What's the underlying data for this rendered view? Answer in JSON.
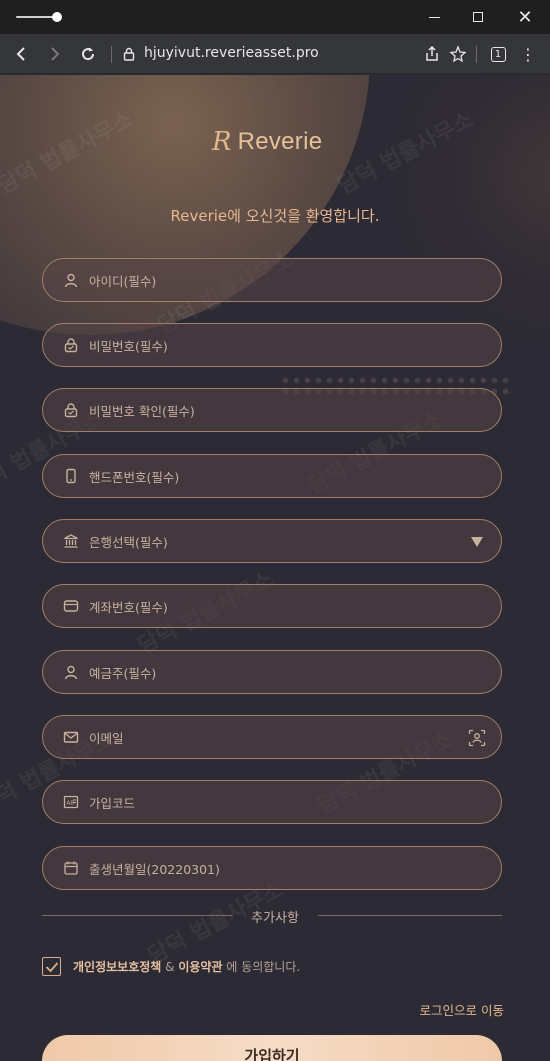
{
  "browser": {
    "url": "hjuyivut.reverieasset.pro",
    "tab_count": "1"
  },
  "logo": {
    "mark": "R",
    "name": "Reverie"
  },
  "welcome": "Reverie에 오신것을 환영합니다.",
  "fields": [
    {
      "label": "아이디(필수)",
      "icon": "user-icon"
    },
    {
      "label": "비밀번호(필수)",
      "icon": "lock-icon"
    },
    {
      "label": "비밀번호 확인(필수)",
      "icon": "lock-icon"
    },
    {
      "label": "핸드폰번호(필수)",
      "icon": "phone-icon"
    },
    {
      "label": "은행선택(필수)",
      "icon": "bank-icon"
    },
    {
      "label": "계좌번호(필수)",
      "icon": "card-icon"
    },
    {
      "label": "예금주(필수)",
      "icon": "user-icon"
    },
    {
      "label": "이메일",
      "icon": "mail-icon"
    },
    {
      "label": "가입코드",
      "icon": "code-icon"
    },
    {
      "label": "출생년월일(20220301)",
      "icon": "calendar-icon"
    }
  ],
  "extra_section": "추가사항",
  "agree": {
    "privacy": "개인정보보호정책",
    "amp": " & ",
    "terms": "이용약관",
    "suffix": " 에 동의합니다.",
    "checked": true
  },
  "login_link": "로그인으로 이동",
  "signup_button": "가입하기",
  "watermark": "담덕 법률사무소"
}
